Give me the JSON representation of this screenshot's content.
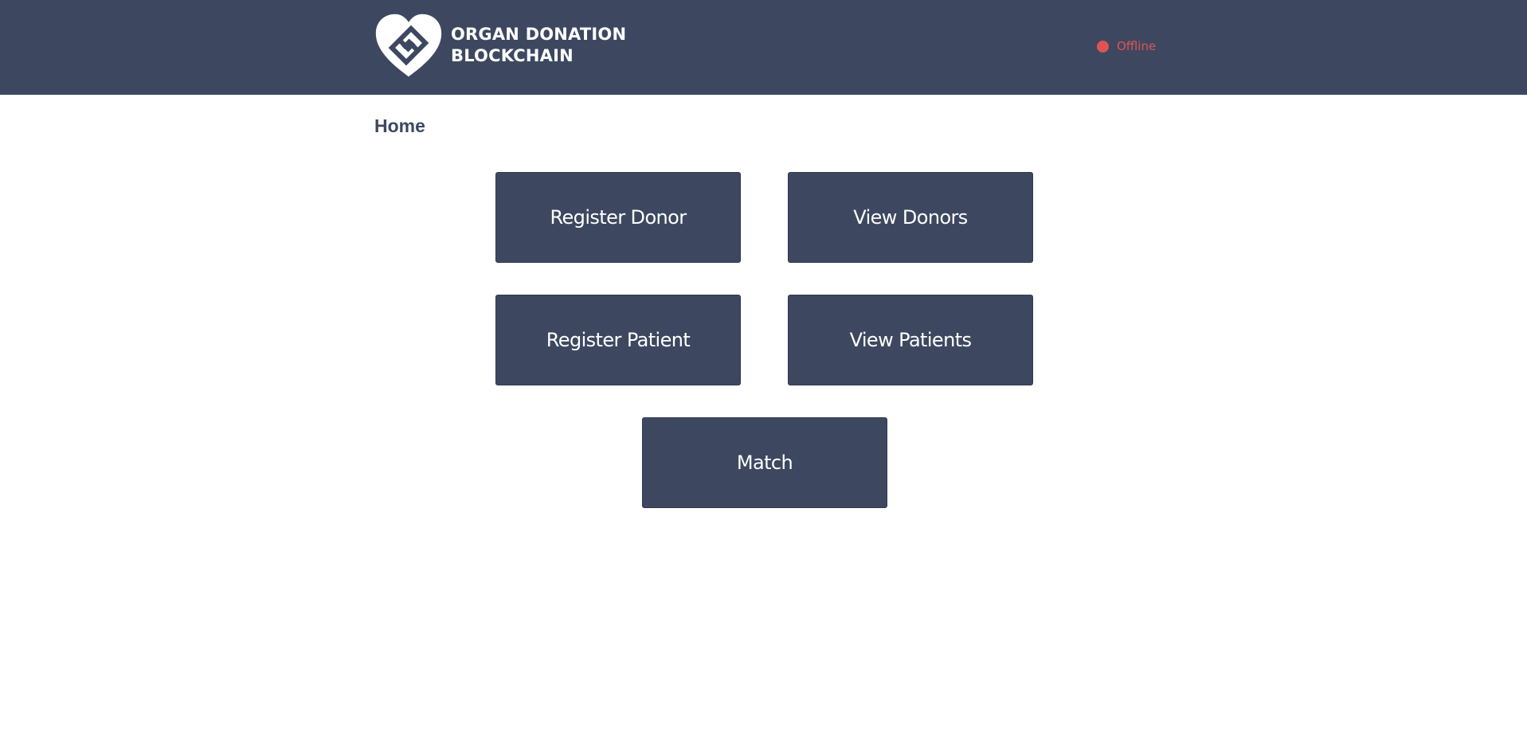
{
  "header": {
    "brand_line1": "ORGAN DONATION",
    "brand_line2": "BLOCKCHAIN",
    "logo_icon": "heart-chain-logo-icon",
    "status_label": "Offline",
    "status_color": "#e05353",
    "background_color": "#3d4860"
  },
  "page": {
    "title": "Home"
  },
  "menu": {
    "register_donor": "Register Donor",
    "view_donors": "View Donors",
    "register_patient": "Register Patient",
    "view_patients": "View Patients",
    "match": "Match",
    "button_color": "#3d4860"
  }
}
